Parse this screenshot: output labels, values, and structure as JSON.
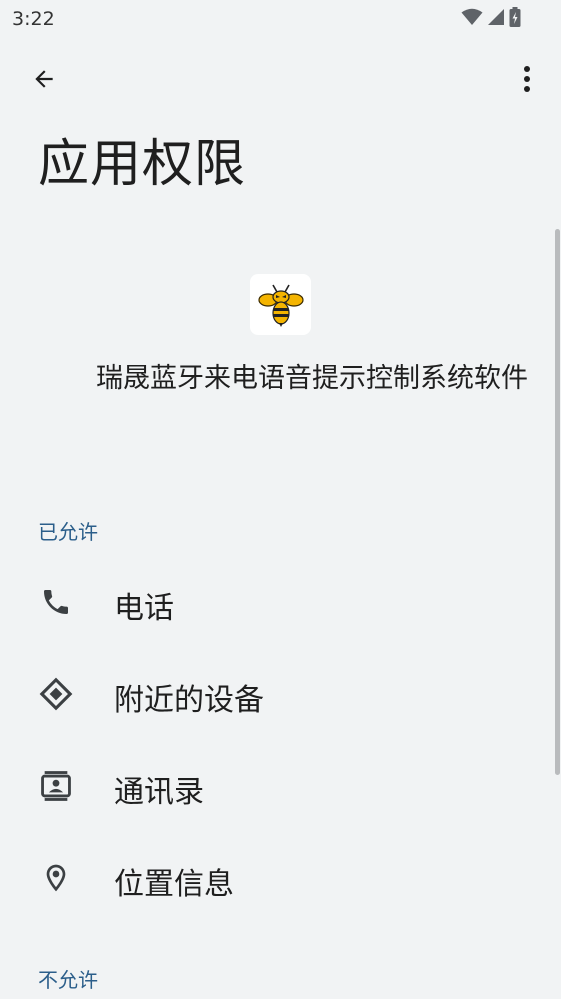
{
  "status_bar": {
    "time": "3:22",
    "icons": [
      "wifi-icon",
      "signal-icon",
      "battery-charging-icon"
    ]
  },
  "toolbar": {
    "back_icon": "arrow-back-icon",
    "more_icon": "more-vert-icon"
  },
  "page": {
    "title": "应用权限"
  },
  "app": {
    "icon": "bee-app-icon",
    "name": "瑞晟蓝牙来电语音提示控制系统软件"
  },
  "sections": {
    "allowed": {
      "header": "已允许",
      "items": [
        {
          "label": "电话",
          "icon": "phone-icon"
        },
        {
          "label": "附近的设备",
          "icon": "nearby-devices-icon"
        },
        {
          "label": "通讯录",
          "icon": "contacts-icon"
        },
        {
          "label": "位置信息",
          "icon": "location-icon"
        }
      ]
    },
    "denied": {
      "header": "不允许"
    }
  },
  "colors": {
    "background": "#f1f3f4",
    "section_header": "#2b5e8a",
    "text": "#1f1f1f",
    "icon": "#3c4043"
  }
}
